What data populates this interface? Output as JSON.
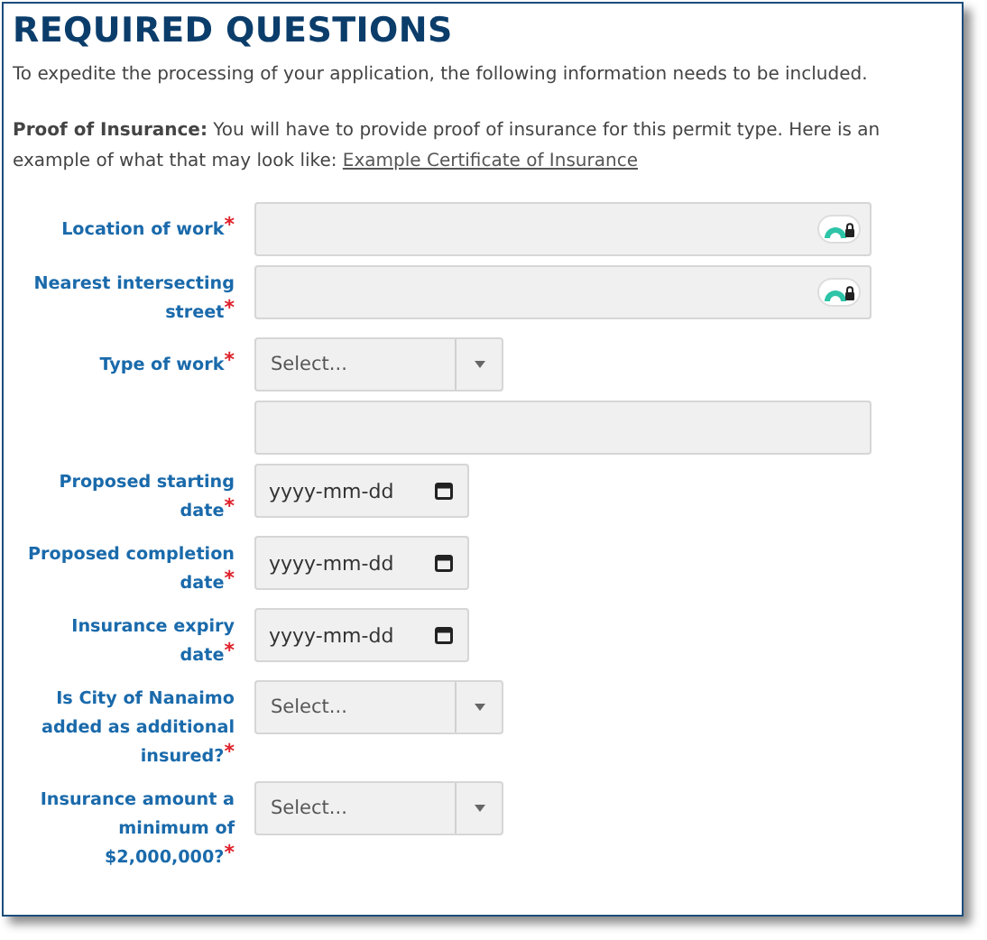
{
  "title": "REQUIRED QUESTIONS",
  "intro": "To expedite the processing of your application, the following information needs to be included.",
  "notice": {
    "text": "**Proof of Insurance:** You will have to provide proof of insurance for this permit type. Here is an example of what that may look like:",
    "link": "Example Certificate of Insurance"
  },
  "fields": [
    {
      "kind": "text",
      "label": "Location of work",
      "mark": "*",
      "badge": true
    },
    {
      "kind": "text",
      "label": "Nearest intersecting street",
      "mark": "*",
      "badge": true
    },
    {
      "kind": "select",
      "label": "Type of work",
      "mark": "*",
      "placeholder": "Select..."
    },
    {
      "kind": "text",
      "badge": false
    },
    {
      "kind": "date",
      "label": "Proposed starting date",
      "mark": "*",
      "placeholder": "yyyy-mm-dd"
    },
    {
      "kind": "date",
      "label": "Proposed completion date",
      "mark": "*",
      "placeholder": "yyyy-mm-dd"
    },
    {
      "kind": "date",
      "label": "Insurance expiry date",
      "mark": "*",
      "placeholder": "yyyy-mm-dd"
    },
    {
      "kind": "select",
      "label": "Is City of Nanaimo added as additional insured?",
      "mark": "*",
      "placeholder": "Select..."
    },
    {
      "kind": "select",
      "label": "Insurance amount a minimum of $2,000,000?",
      "mark": "*",
      "placeholder": "Select..."
    }
  ]
}
